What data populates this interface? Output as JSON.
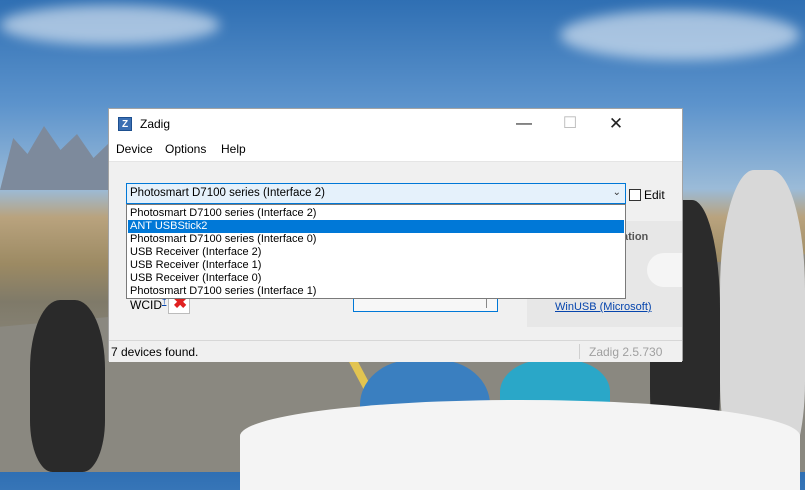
{
  "window": {
    "title": "Zadig",
    "icon_letter": "Z",
    "minimize_glyph": "—",
    "maximize_glyph": "☐",
    "close_glyph": "✕"
  },
  "menu": {
    "items": [
      "Device",
      "Options",
      "Help"
    ]
  },
  "device_select": {
    "selected": "Photosmart D7100 series (Interface 2)",
    "arrow": "⌄",
    "options": [
      "Photosmart D7100 series (Interface 2)",
      "ANT USBStick2",
      "Photosmart D7100 series (Interface 0)",
      "USB Receiver (Interface 2)",
      "USB Receiver (Interface 1)",
      "USB Receiver (Interface 0)",
      "Photosmart D7100 series (Interface 1)"
    ],
    "highlighted_index": 1
  },
  "edit": {
    "label": "Edit",
    "checked": false
  },
  "wcid": {
    "label": "WCID",
    "sup": "†",
    "status_glyph": "✖"
  },
  "driver_panel": {
    "heading_partial": "ation",
    "link_partial": ")",
    "link": "WinUSB (Microsoft)"
  },
  "status": {
    "text": "7 devices found.",
    "version": "Zadig 2.5.730"
  },
  "colors": {
    "accent": "#0078d7",
    "selection_text": "#ffffff",
    "link": "#0645ad",
    "error_x": "#e02020"
  }
}
